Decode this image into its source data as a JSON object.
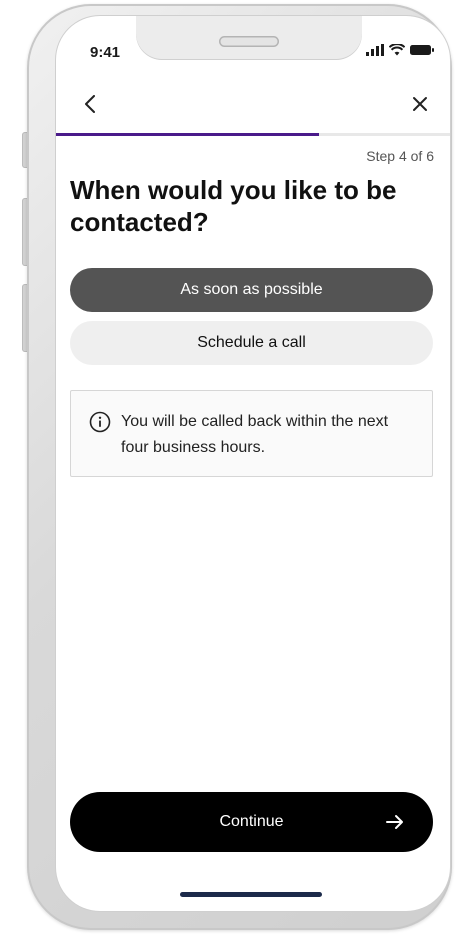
{
  "status_bar": {
    "time": "9:41"
  },
  "nav": {
    "back_icon": "chevron-left-icon",
    "close_icon": "close-icon"
  },
  "progress": {
    "current_step": 4,
    "total_steps": 6,
    "fill_fraction": 0.667,
    "color": "#4a1a8a",
    "label": "Step 4 of 6"
  },
  "page": {
    "title": "When would you like to be contacted?"
  },
  "options": [
    {
      "label": "As soon as possible",
      "selected": true
    },
    {
      "label": "Schedule a call",
      "selected": false
    }
  ],
  "info": {
    "icon": "info-icon",
    "text": "You will be called back within the next four business hours."
  },
  "footer": {
    "continue_label": "Continue",
    "continue_icon": "arrow-right-icon"
  },
  "colors": {
    "selected_option": "#545454",
    "unselected_option": "#efefef",
    "primary_button": "#000000"
  }
}
